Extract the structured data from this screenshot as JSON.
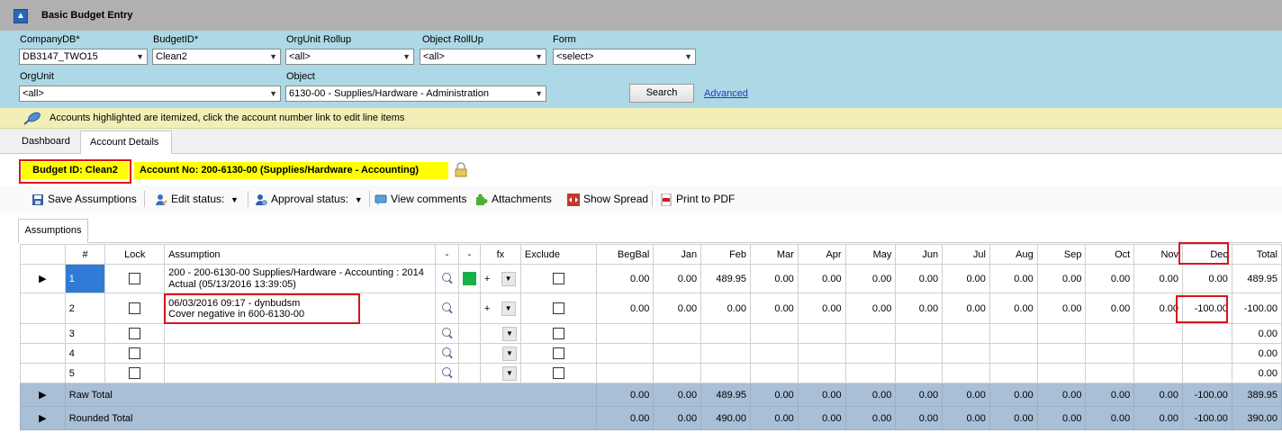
{
  "window": {
    "title": "Basic Budget Entry"
  },
  "filters": {
    "company": {
      "label": "CompanyDB*",
      "value": "DB3147_TWO15"
    },
    "budget": {
      "label": "BudgetID*",
      "value": "Clean2"
    },
    "orgunit_rollup": {
      "label": "OrgUnit Rollup",
      "value": "<all>"
    },
    "object_rollup": {
      "label": "Object RollUp",
      "value": "<all>"
    },
    "form": {
      "label": "Form",
      "value": "<select>"
    },
    "orgunit": {
      "label": "OrgUnit",
      "value": "<all>"
    },
    "object": {
      "label": "Object",
      "value": "6130-00 - Supplies/Hardware - Administration"
    },
    "search_label": "Search",
    "advanced_label": "Advanced"
  },
  "info": {
    "message": "Accounts highlighted are itemized, click the account number link to edit line items"
  },
  "tabs": [
    {
      "label": "Dashboard"
    },
    {
      "label": "Account Details"
    }
  ],
  "header": {
    "budget_id": "Budget ID: Clean2",
    "account_no": "Account No: 200-6130-00 (Supplies/Hardware - Accounting)"
  },
  "toolbar": {
    "save": "Save Assumptions",
    "edit_status": "Edit status:",
    "approval_status": "Approval status:",
    "view_comments": "View comments",
    "attachments": "Attachments",
    "show_spread": "Show Spread",
    "print_pdf": "Print to PDF"
  },
  "subtab": "Assumptions",
  "grid": {
    "columns": [
      "#",
      "Lock",
      "Assumption",
      "-",
      "-",
      "fx",
      "Exclude",
      "BegBal",
      "Jan",
      "Feb",
      "Mar",
      "Apr",
      "May",
      "Jun",
      "Jul",
      "Aug",
      "Sep",
      "Oct",
      "Nov",
      "Dec",
      "Total"
    ],
    "rows": [
      {
        "num": "1",
        "assumption_line1": "200  -  200-6130-00 Supplies/Hardware - Accounting : 2014",
        "assumption_line2": "Actual (05/13/2016 13:39:05)",
        "fx": "+",
        "values": [
          "0.00",
          "0.00",
          "489.95",
          "0.00",
          "0.00",
          "0.00",
          "0.00",
          "0.00",
          "0.00",
          "0.00",
          "0.00",
          "0.00",
          "0.00",
          "489.95"
        ]
      },
      {
        "num": "2",
        "assumption_line1": "06/03/2016 09:17 - dynbudsm",
        "assumption_line2": "Cover negative in 600-6130-00",
        "fx": "+",
        "values": [
          "0.00",
          "0.00",
          "0.00",
          "0.00",
          "0.00",
          "0.00",
          "0.00",
          "0.00",
          "0.00",
          "0.00",
          "0.00",
          "0.00",
          "-100.00",
          "-100.00"
        ]
      },
      {
        "num": "3",
        "total": "0.00"
      },
      {
        "num": "4",
        "total": "0.00"
      },
      {
        "num": "5",
        "total": "0.00"
      }
    ],
    "totals": [
      {
        "label": "Raw Total",
        "values": [
          "0.00",
          "0.00",
          "489.95",
          "0.00",
          "0.00",
          "0.00",
          "0.00",
          "0.00",
          "0.00",
          "0.00",
          "0.00",
          "0.00",
          "-100.00",
          "389.95"
        ]
      },
      {
        "label": "Rounded Total",
        "values": [
          "0.00",
          "0.00",
          "490.00",
          "0.00",
          "0.00",
          "0.00",
          "0.00",
          "0.00",
          "0.00",
          "0.00",
          "0.00",
          "0.00",
          "-100.00",
          "390.00"
        ]
      }
    ]
  },
  "colors": {
    "filter_bg": "#add8e6",
    "highlight": "#ffff00",
    "annotation": "#d8141b",
    "totals_bg": "#a9bfd6"
  }
}
